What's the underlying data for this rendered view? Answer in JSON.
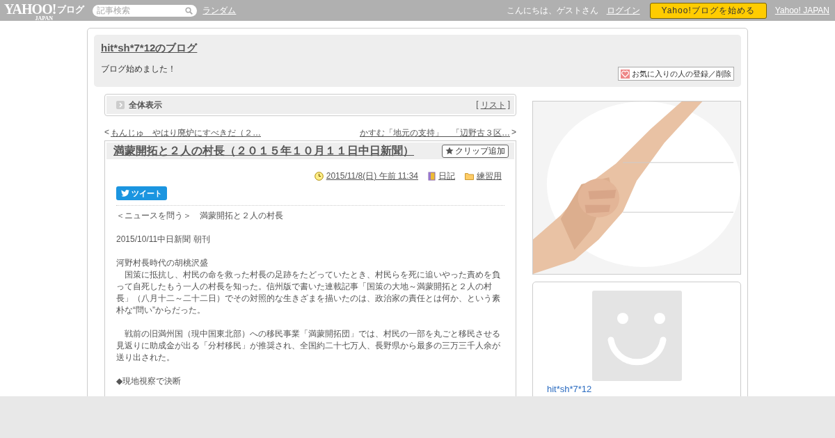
{
  "top_bar": {
    "logo": {
      "main": "YAHOO!",
      "sub": "JAPAN",
      "product": "ブログ"
    },
    "search": {
      "placeholder": "記事検索"
    },
    "random_link": "ランダム",
    "greeting": "こんにちは、ゲストさん",
    "login_link": "ログイン",
    "start_button": "Yahoo!ブログを始める",
    "japan_link": "Yahoo! JAPAN"
  },
  "blog_header": {
    "title": "hit*sh*7*12のブログ",
    "description": "ブログ始めました！",
    "favorite_button": "お気に入りの人の登録／削除"
  },
  "view_bar": {
    "label": "全体表示",
    "open_bracket": "[",
    "list_link": "リスト",
    "close_bracket": "]"
  },
  "nav": {
    "prev_mark": "<",
    "prev": "もんじゅ　やはり廃炉にすべきだ（２…",
    "next": "かすむ「地元の支持」　「辺野古３区…",
    "next_mark": ">"
  },
  "article": {
    "title": "満蒙開拓と２人の村長（２０１５年１０月１１日中日新聞）",
    "clip_button": "クリップ追加",
    "date": "2015/11/8(日) 午前 11:34",
    "category": "日記",
    "folder": "練習用",
    "tweet_button": "ツイート",
    "blocks": [
      [
        "＜ニュースを問う＞　満蒙開拓と２人の村長"
      ],
      [
        "2015/10/11中日新聞 朝刊"
      ],
      [
        "河野村長時代の胡桃沢盛",
        "　国策に抵抗し、村民の命を救った村長の足跡をたどっていたとき、村民らを死に追いやった責めを負って自死したもう一人の村長を知った。信州版で書いた連載記事「国策の大地～満蒙開拓と２人の村長」（八月十二～二十二日）でその対照的な生きざまを描いたのは、政治家の責任とは何か、という素朴な“問い”からだった。"
      ],
      [
        "　戦前の旧満州国（現中国東北部）への移民事業「満蒙開拓団」では、村民の一部を丸ごと移民させる見返りに助成金が出る「分村移民」が推奨され、全国約二十七万人、長野県から最多の三万三千人余が送り出された。"
      ],
      [
        "◆現地視察で決断"
      ]
    ]
  },
  "sidebar": {
    "profile": {
      "name": "hit*sh*7*12"
    }
  }
}
